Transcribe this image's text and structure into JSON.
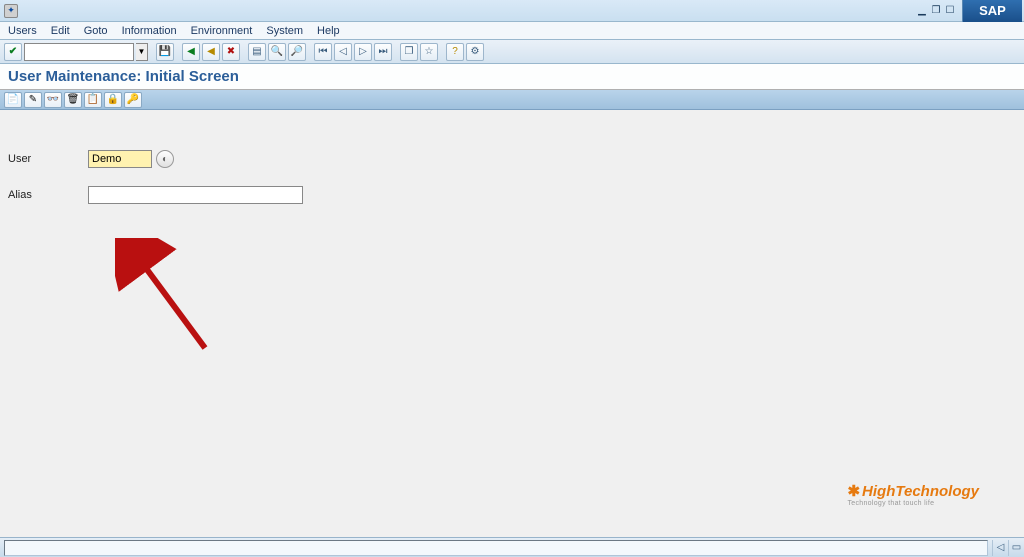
{
  "titlebar": {
    "window_controls": [
      "minimize",
      "restore",
      "maximize"
    ]
  },
  "sap_logo_text": "SAP",
  "menubar": {
    "items": [
      "Users",
      "Edit",
      "Goto",
      "Information",
      "Environment",
      "System",
      "Help"
    ]
  },
  "toolbar": {
    "tcode_value": ""
  },
  "page_title": "User Maintenance: Initial Screen",
  "apptoolbar_icons": [
    "create",
    "edit",
    "display-tech",
    "delete",
    "copy",
    "lock",
    "other"
  ],
  "fields": {
    "user_label": "User",
    "user_value": "Demo",
    "alias_label": "Alias",
    "alias_value": ""
  },
  "watermark": {
    "name": "HighTechnology",
    "tag": "Technology that touch life"
  },
  "icons": {
    "green_check": "✓",
    "save": "💾",
    "back": "◀",
    "exit": "◀",
    "cancel": "✖",
    "print": "▤",
    "find": "🔍",
    "findnext": "🔎",
    "first": "⏮",
    "prev": "◁",
    "next": "▷",
    "last": "⏭",
    "newsession": "❐",
    "shortcut": "☆",
    "help": "?"
  }
}
